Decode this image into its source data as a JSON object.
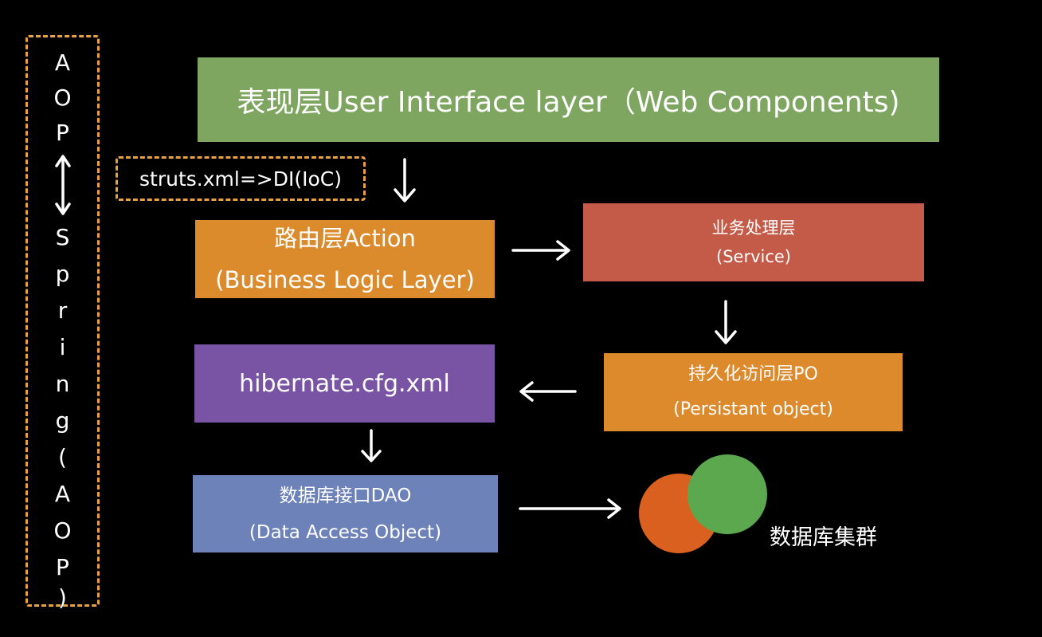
{
  "ui_layer": {
    "text": "表现层User Interface layer（Web Components)"
  },
  "struts_label": "struts.xml=>DI(IoC)",
  "action_layer": {
    "line1": "路由层Action",
    "line2": "(Business Logic Layer)"
  },
  "service_layer": {
    "line1": "业务处理层",
    "line2": "(Service)"
  },
  "persist_layer": {
    "line1": "持久化访问层PO",
    "line2": "(Persistant object)"
  },
  "hibernate_layer": {
    "text": "hibernate.cfg.xml"
  },
  "dao_layer": {
    "line1": "数据库接口DAO",
    "line2": "(Data Access Object)"
  },
  "cluster_label": "数据库集群",
  "aop_sidebar": {
    "top_chars": [
      "A",
      "O",
      "P"
    ],
    "bottom_chars": [
      "S",
      "p",
      "r",
      "i",
      "n",
      "g",
      "(",
      "A",
      "O",
      "P",
      ")"
    ]
  },
  "colors": {
    "ui": "#7fa660",
    "action": "#db8a2c",
    "service": "#c35b48",
    "persist": "#dc8a2c",
    "hibernate": "#7a54a4",
    "dao": "#6d82b8",
    "frame": "#e6a243",
    "circle_orange": "#d9601f",
    "circle_green": "#5ba84e"
  }
}
